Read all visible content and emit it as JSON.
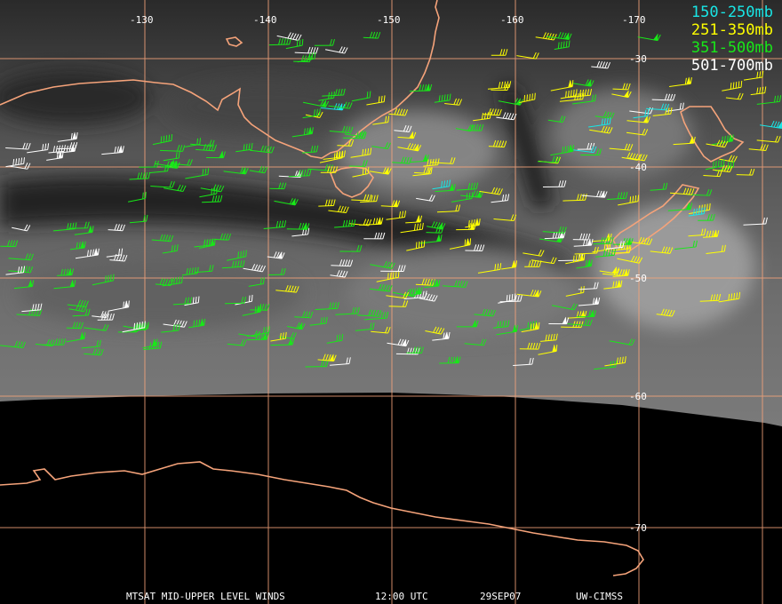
{
  "colors": {
    "grid": "#f5a37a",
    "coast": "#f5a37a",
    "background": "#000000",
    "cloud_light": "#9a9a9a",
    "cloud_dark": "#3a3a3a",
    "text": "#ffffff"
  },
  "legend": [
    {
      "label": "150-250mb",
      "color": "#19e6e6"
    },
    {
      "label": "251-350mb",
      "color": "#ffff00"
    },
    {
      "label": "351-500mb",
      "color": "#18e818"
    },
    {
      "label": "501-700mb",
      "color": "#ffffff"
    }
  ],
  "longitude_labels": [
    "-130",
    "-140",
    "-150",
    "-160",
    "-170"
  ],
  "latitude_labels": [
    "-30",
    "-40",
    "-50",
    "-60",
    "-70"
  ],
  "footer": {
    "product": "MTSAT MID-UPPER LEVEL WINDS",
    "time": "12:00 UTC",
    "date": "29SEP07",
    "source": "UW-CIMSS"
  }
}
